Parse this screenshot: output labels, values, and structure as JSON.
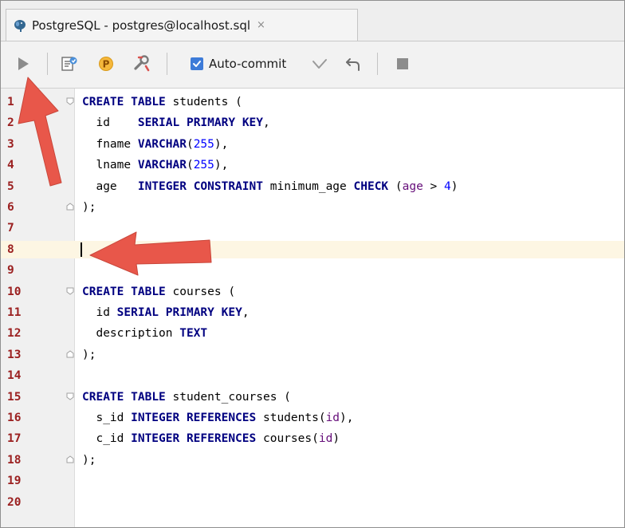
{
  "tab": {
    "title": "PostgreSQL - postgres@localhost.sql",
    "close": "×"
  },
  "toolbar": {
    "autocommit_label": "Auto-commit",
    "autocommit_checked": true,
    "icons": [
      "run-icon",
      "explain-plan-icon",
      "parameters-icon",
      "settings-wrench-icon",
      "commit-check-icon",
      "rollback-icon",
      "stop-icon"
    ]
  },
  "editor": {
    "current_line": 8,
    "lines": [
      {
        "n": "1",
        "t": "CREATE TABLE students ("
      },
      {
        "n": "2",
        "t": "  id    SERIAL PRIMARY KEY,"
      },
      {
        "n": "3",
        "t": "  fname VARCHAR(255),"
      },
      {
        "n": "4",
        "t": "  lname VARCHAR(255),"
      },
      {
        "n": "5",
        "t": "  age   INTEGER CONSTRAINT minimum_age CHECK (age > 4)"
      },
      {
        "n": "6",
        "t": ");"
      },
      {
        "n": "7",
        "t": ""
      },
      {
        "n": "8",
        "t": ""
      },
      {
        "n": "9",
        "t": ""
      },
      {
        "n": "10",
        "t": "CREATE TABLE courses ("
      },
      {
        "n": "11",
        "t": "  id SERIAL PRIMARY KEY,"
      },
      {
        "n": "12",
        "t": "  description TEXT"
      },
      {
        "n": "13",
        "t": ");"
      },
      {
        "n": "14",
        "t": ""
      },
      {
        "n": "15",
        "t": "CREATE TABLE student_courses ("
      },
      {
        "n": "16",
        "t": "  s_id INTEGER REFERENCES students(id),"
      },
      {
        "n": "17",
        "t": "  c_id INTEGER REFERENCES courses(id)"
      },
      {
        "n": "18",
        "t": ");"
      },
      {
        "n": "19",
        "t": ""
      },
      {
        "n": "20",
        "t": ""
      }
    ]
  },
  "colors": {
    "keyword": "#000080",
    "number": "#0000ff",
    "column": "#660e7a",
    "line_number": "#9b2020",
    "current_line_bg": "#fdf6e3",
    "arrow": "#e8574a",
    "checkbox": "#3d7bd8"
  }
}
